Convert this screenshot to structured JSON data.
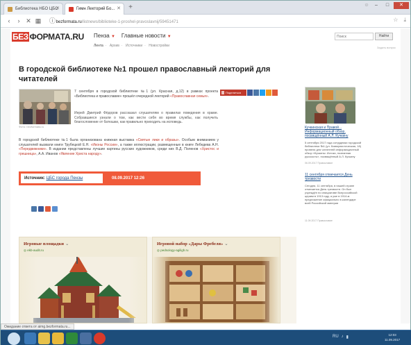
{
  "browser": {
    "tabs": [
      {
        "label": "Библиотека НБО ЦБС"
      },
      {
        "label": "Гимн Лекторий Бо..."
      }
    ],
    "new_tab": "+",
    "address": {
      "host": "bezformata.ru",
      "path": "/listnews/biblioteke-1-proshel-pravoslavnij/59451471"
    }
  },
  "site": {
    "logo_part1": "БЕЗ",
    "logo_part2": "ФОРМАТА.RU",
    "menu": [
      {
        "label": "Пенза"
      },
      {
        "label": "Главные новости"
      }
    ],
    "submenu": [
      "Лента",
      "Архив",
      "Источники",
      "Новостройки"
    ],
    "search_placeholder": "Поиск",
    "search_button": "Найти",
    "header_note": "Задать вопрос"
  },
  "article": {
    "title": "В городской библиотеке №1 прошел православный лекторий для читателей",
    "photo_caption": "Фото: bezformata.ru",
    "lead": {
      "text_a": "7 сентября в городской библиотеке №1 (ул. Красная, д.12) в рамках проекта «Библиотека и православие» прошёл очередной лекторий ",
      "link": "«Православная семья»",
      "text_b": "."
    },
    "paragraph2": "Иерей Дмитрий Фёдоров рассказал слушателям о правилах поведения в храме. Собравшиеся узнали о том, как вести себя во время службы, как получить благословение от батюшки, как правильно приходить на исповедь.",
    "paragraph3": {
      "text_a": "В городской библиотеке №1 была организована книжная выставка ",
      "link_a": "«Святые лики и образы»",
      "text_b": ". Особым вниманием у слушателей вызвали книги Трубецкой Е.Н. ",
      "link_b": "«Иконы России»",
      "text_c": ", а также иллюстрации, размещенные в книге Лебедева А.Н. ",
      "link_c": "«Передвижники»",
      "text_d": ". В издании представлены лучшие картины русских художников, среди них В.Д. Поленов ",
      "link_d": "«Христос и грешница»",
      "text_e": ", А.А. Иванов ",
      "link_e": "«Явление Христа народу»",
      "text_f": "."
    },
    "share": {
      "label": "Поделиться"
    },
    "source": {
      "label": "Источник:",
      "link": "ЦБС города Пензы",
      "date": "08.09.2017 12:26"
    }
  },
  "sidebar": {
    "item1": {
      "title": "Кучкинская и Правой... Информационный обзор, посвящённый А.Л. Кучкину",
      "text": "5 сентября 2017 года сотрудники городской библиотеки №1 (ул. Коммунистическая, 18) провели для читателей информационный обзор «Кучкины: Истоки, познанная русскость», посвящённый А.Л. Кучкину",
      "date": "06.09.2017 Православие"
    },
    "item2": {
      "title": "11 сентября отмечается День трезвости",
      "text": "Сегодня, 11 сентября, в нашей стране отмечается День трезвости. Он был учреждён по инициативе Всероссийской церкви в 1913 году, а уже в 1914-м предложение официально в календаре всей Российской империи",
      "date": "11.09.2017 Православие"
    }
  },
  "cards": [
    {
      "title": "Игровые площадки",
      "subtitle": "ekb-audit.ru"
    },
    {
      "title": "Игровой набор «Дары Фребеля»",
      "subtitle": "pedsology-agiligh.ru"
    }
  ],
  "statusbar": {
    "text": "Ожидание ответа от aimg.bezformata.ru..."
  },
  "taskbar": {
    "clock_time": "12:03",
    "clock_date": "11.09.2017",
    "tray_lang": "RU"
  },
  "colors": {
    "accent": "#d93a2b",
    "source_box": "#f05a3a",
    "link": "#1a4e8a",
    "card_title": "#8b2d1a",
    "taskbar": "#1d4d7a"
  }
}
